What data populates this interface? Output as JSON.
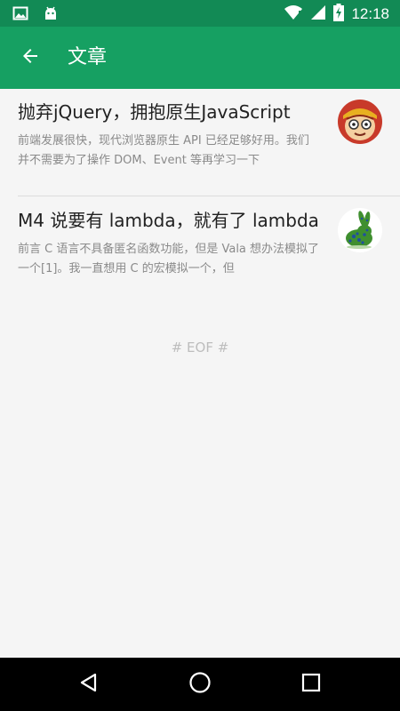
{
  "status_bar": {
    "time": "12:18",
    "icons": [
      "image-icon",
      "android-icon",
      "wifi-icon",
      "signal-icon",
      "battery-charging-icon"
    ]
  },
  "app_bar": {
    "title": "文章",
    "back_icon": "arrow-back-icon"
  },
  "articles": [
    {
      "title": "抛弃jQuery，拥抱原生JavaScript",
      "summary": "前端发展很快，现代浏览器原生 API 已经足够好用。我们并不需要为了操作 DOM、Event 等再学习一下",
      "avatar": "monkey-king-avatar"
    },
    {
      "title": "M4 说要有 lambda，就有了 lambda",
      "summary": "前言 C 语言不具备匿名函数功能，但是 Vala 想办法模拟了一个[1]。我一直想用 C 的宏模拟一个，但",
      "avatar": "green-rabbit-avatar"
    }
  ],
  "footer_text": "# EOF #",
  "nav_bar": {
    "icons": [
      "back-triangle-icon",
      "home-circle-icon",
      "recents-square-icon"
    ]
  },
  "colors": {
    "status_bar": "#128a55",
    "app_bar": "#16a062",
    "background": "#f5f5f5",
    "title_text": "#212121",
    "summary_text": "#8a8a8a"
  }
}
